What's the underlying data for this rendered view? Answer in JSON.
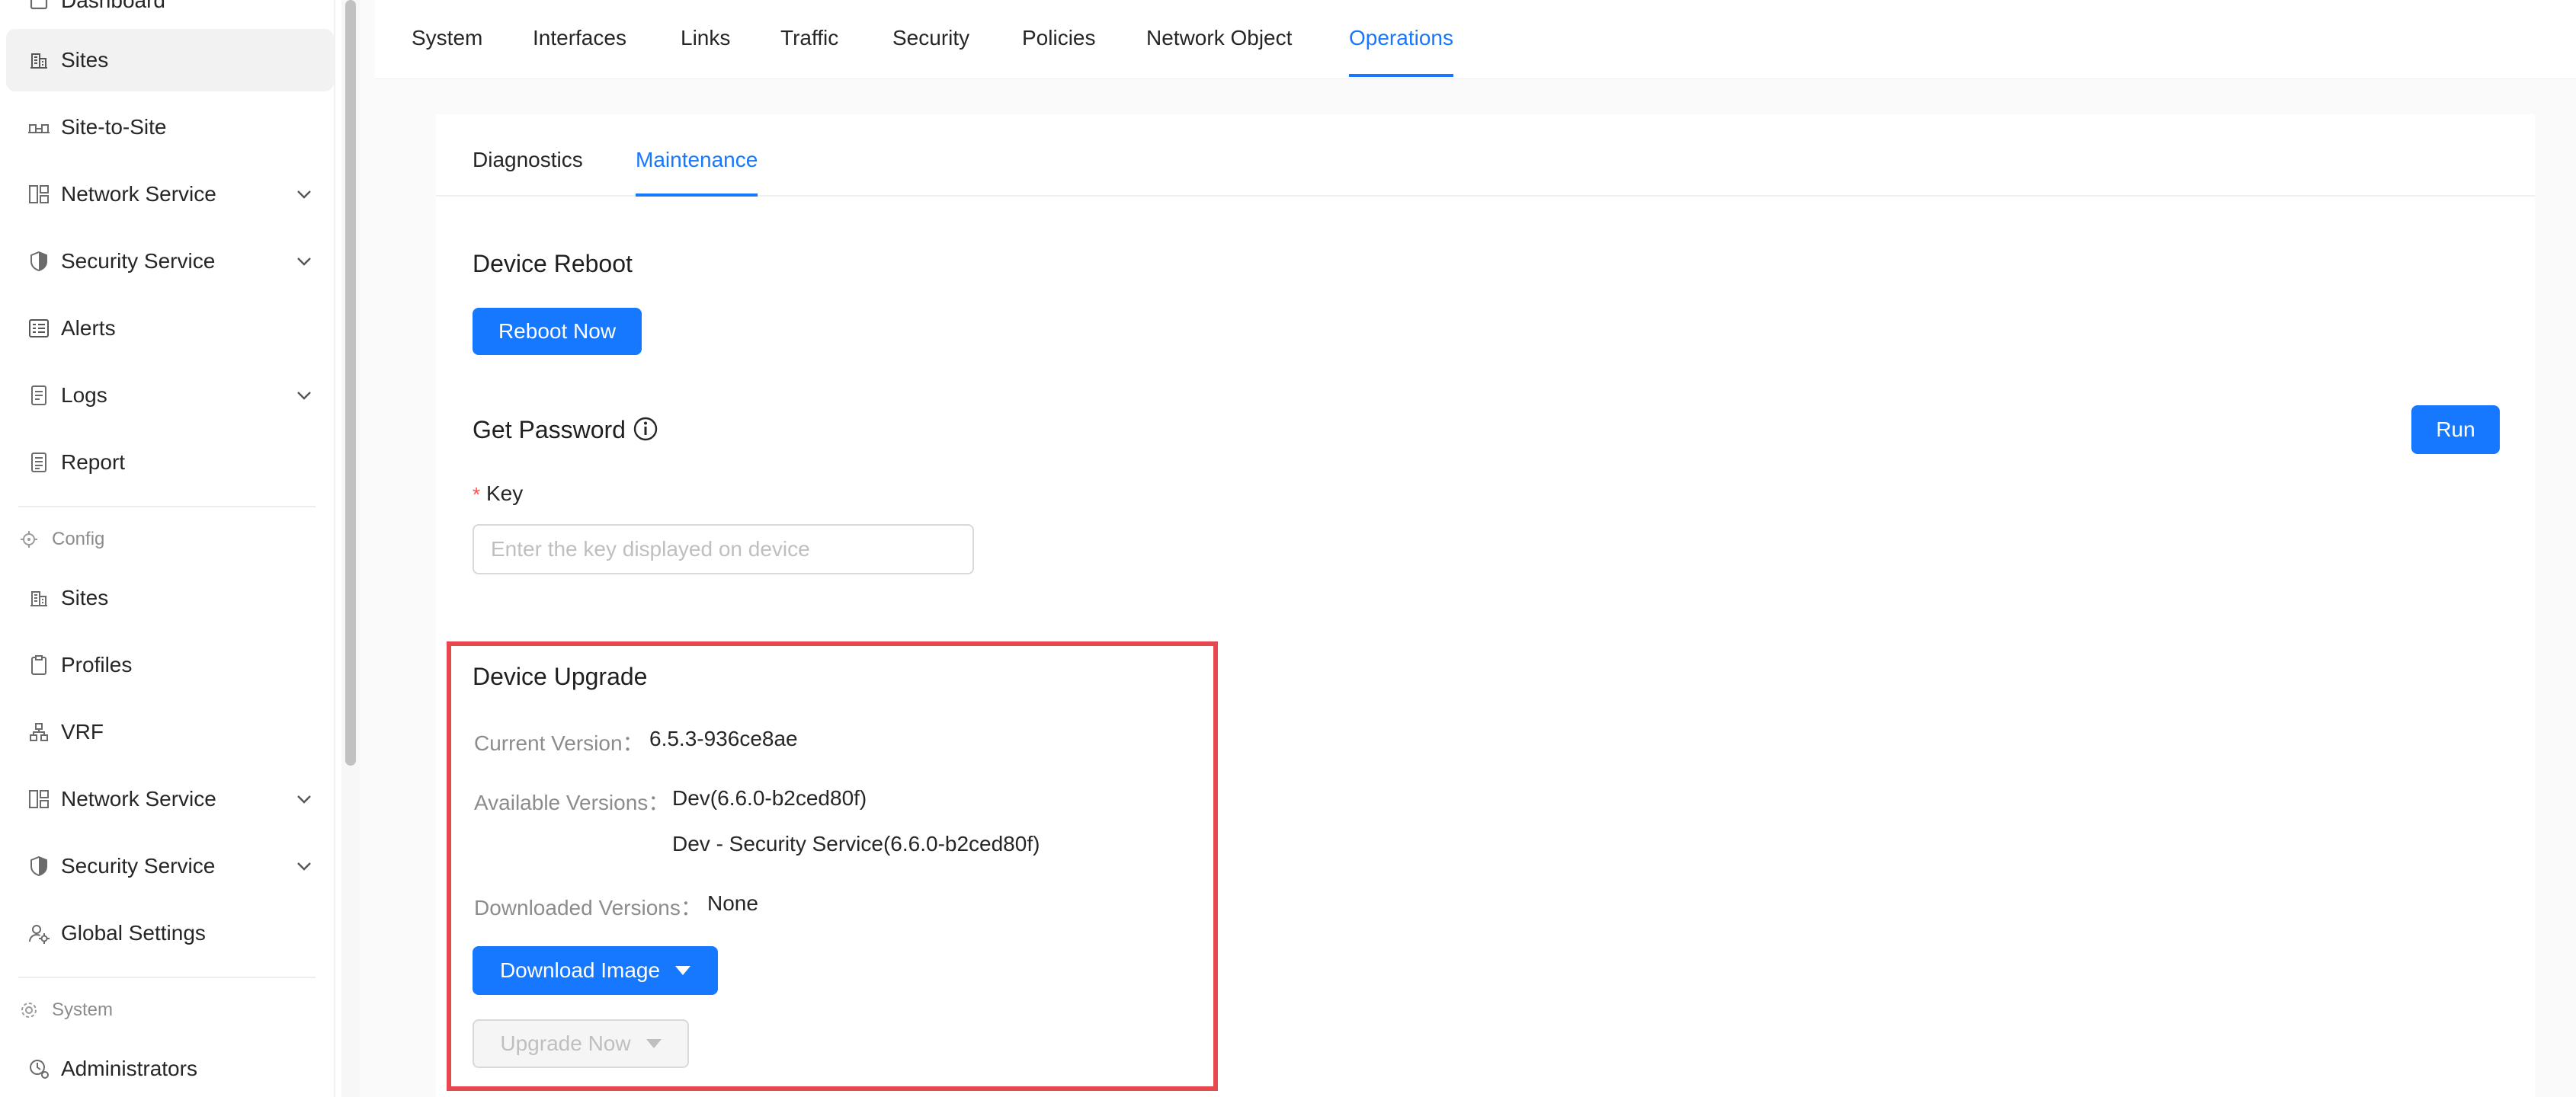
{
  "sidebar": {
    "top_partial_label": "Dashboard",
    "items": [
      {
        "label": "Sites",
        "icon": "building-icon",
        "active": true
      },
      {
        "label": "Site-to-Site",
        "icon": "site-to-site-icon"
      },
      {
        "label": "Network Service",
        "icon": "network-service-icon",
        "expandable": true
      },
      {
        "label": "Security Service",
        "icon": "shield-icon",
        "expandable": true
      },
      {
        "label": "Alerts",
        "icon": "alerts-icon"
      },
      {
        "label": "Logs",
        "icon": "logs-icon",
        "expandable": true
      },
      {
        "label": "Report",
        "icon": "report-icon"
      }
    ],
    "config_group": "Config",
    "config_items": [
      {
        "label": "Sites",
        "icon": "building-icon"
      },
      {
        "label": "Profiles",
        "icon": "clipboard-icon"
      },
      {
        "label": "VRF",
        "icon": "vrf-icon"
      },
      {
        "label": "Network Service",
        "icon": "network-service-icon",
        "expandable": true
      },
      {
        "label": "Security Service",
        "icon": "shield-icon",
        "expandable": true
      },
      {
        "label": "Global Settings",
        "icon": "user-settings-icon"
      }
    ],
    "system_group": "System",
    "system_items": [
      {
        "label": "Administrators",
        "icon": "admin-icon"
      }
    ]
  },
  "top_tabs": [
    "System",
    "Interfaces",
    "Links",
    "Traffic",
    "Security",
    "Policies",
    "Network Object",
    "Operations"
  ],
  "active_top_tab": "Operations",
  "sub_tabs": [
    "Diagnostics",
    "Maintenance"
  ],
  "active_sub_tab": "Maintenance",
  "reboot": {
    "title": "Device Reboot",
    "button": "Reboot Now"
  },
  "password": {
    "title": "Get Password",
    "run_button": "Run",
    "required_mark": "*",
    "key_label": "Key",
    "key_placeholder": "Enter the key displayed on device",
    "key_value": ""
  },
  "upgrade": {
    "title": "Device Upgrade",
    "current_version_label": "Current Version：",
    "current_version": "6.5.3-936ce8ae",
    "available_versions_label": "Available Versions：",
    "available_versions": [
      "Dev(6.6.0-b2ced80f)",
      "Dev - Security Service(6.6.0-b2ced80f)"
    ],
    "downloaded_versions_label": "Downloaded Versions：",
    "downloaded_versions": "None",
    "download_button": "Download Image",
    "upgrade_button": "Upgrade Now"
  },
  "colors": {
    "accent": "#1677ff",
    "highlight": "#e5484d",
    "required": "#ff4d4f"
  }
}
